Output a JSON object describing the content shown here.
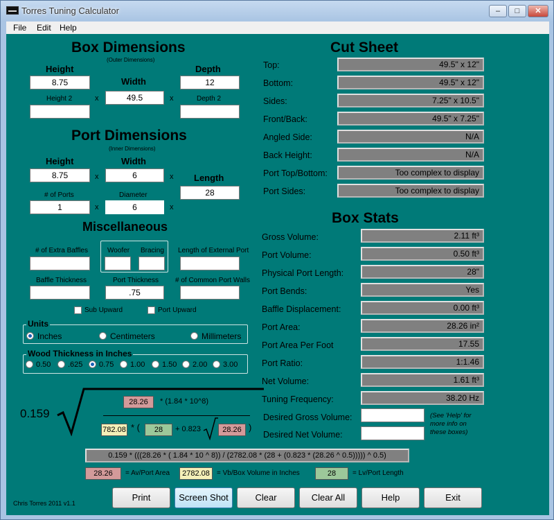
{
  "window": {
    "title": "Torres Tuning Calculator"
  },
  "menu": {
    "file": "File",
    "edit": "Edit",
    "help": "Help"
  },
  "box": {
    "title": "Box Dimensions",
    "subtitle": "(Outer Dimensions)",
    "height_label": "Height",
    "height_value": "8.75",
    "width_label": "Width",
    "width_value": "49.5",
    "depth_label": "Depth",
    "depth_value": "12",
    "height2_placeholder": "Height 2",
    "depth2_placeholder": "Depth 2"
  },
  "port": {
    "title": "Port Dimensions",
    "subtitle": "(Inner Dimensions)",
    "height_label": "Height",
    "height_value": "8.75",
    "width_label": "Width",
    "width_value": "6",
    "length_label": "Length",
    "length_value": "28",
    "num_ports_label": "# of Ports",
    "num_ports_value": "1",
    "diameter_label": "Diameter",
    "diameter_value": "6"
  },
  "misc": {
    "title": "Miscellaneous",
    "extra_baffles_label": "# of Extra Baffles",
    "extra_baffles_value": "",
    "woofer_label": "Woofer",
    "woofer_value": "",
    "bracing_label": "Bracing",
    "bracing_value": "",
    "external_port_label": "Length of External Port",
    "external_port_value": "",
    "baffle_thickness_label": "Baffle Thickness",
    "baffle_thickness_value": "",
    "port_thickness_label": "Port Thickness",
    "port_thickness_value": ".75",
    "common_walls_label": "# of Common Port Walls",
    "common_walls_value": "",
    "sub_upward_label": "Sub Upward",
    "port_upward_label": "Port Upward"
  },
  "units": {
    "title": "Units",
    "inches": "Inches",
    "centimeters": "Centimeters",
    "millimeters": "Millimeters",
    "selected": "Inches"
  },
  "wood": {
    "title": "Wood Thickness in Inches",
    "options": [
      "0.50",
      ".625",
      "0.75",
      "1.00",
      "1.50",
      "2.00",
      "3.00"
    ],
    "selected": "0.75"
  },
  "formula": {
    "coefficient": "0.159",
    "top_value": "28.26",
    "top_rest": "* (1.84 * 10^8)",
    "bottom_vb": "782.08",
    "bottom_star": "* (",
    "bottom_lv": "28",
    "bottom_plus": "+ 0.823",
    "bottom_av": "28.26",
    "bottom_close": ")",
    "full_expression": "0.159 * (((28.26 * ( 1.84 * 10 ^ 8)) / (2782.08 * (28 + (0.823 * (28.26 ^ 0.5))))) ^ 0.5)",
    "legend_av": "28.26",
    "legend_av_text": "= Av/Port Area",
    "legend_vb": "2782.08",
    "legend_vb_text": "= Vb/Box Volume in Inches",
    "legend_lv": "28",
    "legend_lv_text": "= Lv/Port Length"
  },
  "cut_sheet": {
    "title": "Cut Sheet",
    "rows": [
      {
        "label": "Top:",
        "value": "49.5\" x 12\""
      },
      {
        "label": "Bottom:",
        "value": "49.5\" x 12\""
      },
      {
        "label": "Sides:",
        "value": "7.25\" x 10.5\""
      },
      {
        "label": "Front/Back:",
        "value": "49.5\" x 7.25\""
      },
      {
        "label": "Angled Side:",
        "value": "N/A"
      },
      {
        "label": "Back Height:",
        "value": "N/A"
      },
      {
        "label": "Port Top/Bottom:",
        "value": "Too complex to display"
      },
      {
        "label": "Port Sides:",
        "value": "Too complex to display"
      }
    ]
  },
  "box_stats": {
    "title": "Box Stats",
    "rows": [
      {
        "label": "Gross Volume:",
        "value": "2.11 ft³"
      },
      {
        "label": "Port Volume:",
        "value": "0.50 ft³"
      },
      {
        "label": "Physical Port Length:",
        "value": "28\""
      },
      {
        "label": "Port Bends:",
        "value": "Yes"
      },
      {
        "label": "Baffle Displacement:",
        "value": "0.00 ft³"
      },
      {
        "label": "Port Area:",
        "value": "28.26 in²"
      },
      {
        "label": "Port Area Per Foot",
        "value": "17.55"
      },
      {
        "label": "Port Ratio:",
        "value": "1:1.46"
      },
      {
        "label": "Net Volume:",
        "value": "1.61 ft³"
      },
      {
        "label": "Tuning Frequency:",
        "value": "38.20 Hz"
      }
    ],
    "desired_gross_label": "Desired Gross Volume:",
    "desired_net_label": "Desired Net Volume:",
    "desired_gross_value": "",
    "desired_net_value": "",
    "help_note": "(See 'Help' for more info on these boxes)"
  },
  "footer": {
    "credit": "Chris Torres 2011 v1.1",
    "print": "Print",
    "screenshot": "Screen Shot",
    "clear": "Clear",
    "clear_all": "Clear All",
    "help": "Help",
    "exit": "Exit"
  },
  "colors": {
    "client_bg": "#007a78",
    "readonly_bg": "#808080"
  }
}
